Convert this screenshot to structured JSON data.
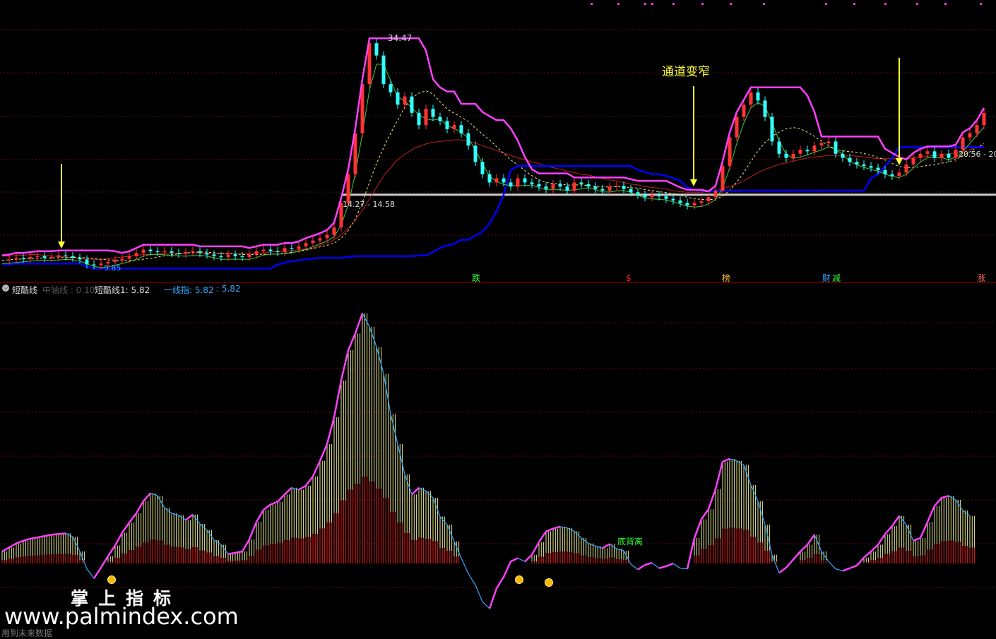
{
  "colors": {
    "background": "#000000",
    "grid": "#5a1515",
    "separator": "#a00000",
    "upper_band": "#ff40ff",
    "lower_band": "#0000ff",
    "mid_band": "#3cc93c",
    "ma_slow": "#c02020",
    "ma_dash": "#f0f080",
    "yellow": "#ffff33",
    "support": "#cccccc",
    "osc_line": "#33aaff",
    "osc_hist_red": "#c01818",
    "osc_hist_yellow": "#e8e890"
  },
  "upper_panel": {
    "peak_label": "34.47",
    "low_label": "5.85",
    "support_label": "14.27 - 14.58",
    "right_label": "20.56 - 20",
    "annotation": "通道变窄",
    "signals": [
      {
        "text": "跌",
        "color": "#33ff33"
      },
      {
        "text": "$",
        "color": "#ff2020"
      },
      {
        "text": "榜",
        "color": "#ffbb33"
      },
      {
        "text": "财",
        "color": "#33aaff"
      },
      {
        "text": "减",
        "color": "#33ff33"
      },
      {
        "text": "涨",
        "color": "#ff6666"
      }
    ]
  },
  "lower_panel": {
    "indicator_name": "短酷线",
    "legend_mid": "中轴线 : 0.10",
    "legend_1": "短酷线1: 5.82",
    "legend_2": "一线指: 5.82",
    "legend_3": ": 5.82",
    "divergence_label": "底背离"
  },
  "watermark": {
    "cn": "掌上指标",
    "url": "www.palmindex.com",
    "note": "用到未来数据"
  },
  "chart_data": [
    {
      "type": "line",
      "title": "",
      "x": [
        0,
        10,
        20,
        30,
        40,
        50,
        60,
        70,
        80,
        90,
        100,
        110,
        120,
        130,
        140,
        150,
        160,
        170,
        180,
        190,
        200,
        210,
        220,
        230,
        240,
        250,
        260,
        270,
        280,
        290,
        300,
        310,
        320,
        330,
        340,
        350,
        360,
        370,
        380,
        390,
        400,
        410,
        420,
        430,
        440,
        450,
        460,
        470,
        480,
        490,
        500,
        510,
        520,
        530,
        540,
        550,
        560,
        570,
        580,
        590,
        600,
        610,
        620,
        630,
        640,
        650,
        660,
        670,
        680,
        690,
        700,
        710,
        720,
        730,
        740,
        750,
        760,
        770,
        780,
        790,
        800,
        810,
        820,
        830,
        840,
        850,
        860,
        870,
        880,
        890,
        900,
        910,
        920,
        930,
        940,
        950,
        960,
        970,
        980,
        990,
        1000,
        1010,
        1020,
        1030,
        1040,
        1050,
        1060,
        1070,
        1080,
        1090,
        1100,
        1110,
        1120,
        1130,
        1140,
        1150,
        1160,
        1170,
        1180,
        1190,
        1200,
        1210,
        1220,
        1230,
        1240,
        1250,
        1260,
        1270,
        1280,
        1290,
        1300,
        1310,
        1320,
        1330,
        1340,
        1350,
        1360,
        1370,
        1380,
        1390
      ],
      "series": [
        {
          "values": [
            6.5,
            6.6,
            6.8,
            6.7,
            6.9,
            7.0,
            6.8,
            6.9,
            7.1,
            7.0,
            6.8,
            6.6,
            6.0,
            5.9,
            6.1,
            6.3,
            6.5,
            6.7,
            7.0,
            7.4,
            7.8,
            7.6,
            7.5,
            7.6,
            7.4,
            7.3,
            7.5,
            7.6,
            7.4,
            7.2,
            7.0,
            6.9,
            7.2,
            7.0,
            6.9,
            7.2,
            7.6,
            7.8,
            7.6,
            7.5,
            8.0,
            7.9,
            8.2,
            8.6,
            8.9,
            9.2,
            9.6,
            10.5,
            13.5,
            17.0,
            22.0,
            28.0,
            33.0,
            31.5,
            28.0,
            27.0,
            25.5,
            26.5,
            24.5,
            23.0,
            25.0,
            24.0,
            23.5,
            22.5,
            23.0,
            22.0,
            20.5,
            18.5,
            17.0,
            16.0,
            16.5,
            16.0,
            15.5,
            16.5,
            16.0,
            15.8,
            15.5,
            15.2,
            15.8,
            15.5,
            15.0,
            16.0,
            15.8,
            15.5,
            15.2,
            15.0,
            15.5,
            15.6,
            15.2,
            14.8,
            14.5,
            14.2,
            14.5,
            14.3,
            14.0,
            13.8,
            13.5,
            13.2,
            13.5,
            13.7,
            14.2,
            15.0,
            18.0,
            21.5,
            24.0,
            25.5,
            27.0,
            26.0,
            24.0,
            21.0,
            19.5,
            19.0,
            19.5,
            20.0,
            19.8,
            20.5,
            20.8,
            21.0,
            19.5,
            19.0,
            18.5,
            18.2,
            18.0,
            17.8,
            17.5,
            17.0,
            16.8,
            17.2,
            18.2,
            19.0,
            19.5,
            19.8,
            19.0,
            19.5,
            19.0,
            20.0,
            21.5,
            22.0,
            23.0,
            24.5
          ]
        },
        {
          "values": [
            7.0,
            7.0,
            7.1,
            7.1,
            7.2,
            7.2,
            7.1,
            7.0,
            7.0,
            6.9,
            6.8,
            6.7,
            6.7,
            6.6,
            6.6,
            6.7,
            6.8,
            6.9,
            7.0,
            7.1,
            7.2,
            7.2,
            7.3,
            7.3,
            7.3,
            7.3,
            7.4,
            7.4,
            7.4,
            7.3,
            7.3,
            7.3,
            7.3,
            7.3,
            7.3,
            7.3,
            7.4,
            7.4,
            7.5,
            7.6,
            7.6,
            7.7,
            7.8,
            7.9,
            8.0,
            8.3,
            8.6,
            9.0,
            9.6,
            10.4,
            11.4,
            12.6,
            14.0,
            15.4,
            16.8,
            17.8,
            18.8,
            19.4,
            20.0,
            20.4,
            20.7,
            20.9,
            21.0,
            21.1,
            21.2,
            21.2,
            21.0,
            20.8,
            20.5,
            20.2,
            19.9,
            19.6,
            19.3,
            19.0,
            18.8,
            18.5,
            18.3,
            18.0,
            17.8,
            17.6,
            17.4,
            17.2,
            17.0,
            16.9,
            16.7,
            16.5,
            16.3,
            16.2,
            16.0,
            15.8,
            15.7,
            15.5,
            15.4,
            15.3,
            15.2,
            15.0,
            14.9,
            14.8,
            14.8,
            14.8,
            14.9,
            15.0,
            15.2,
            15.5,
            15.8,
            16.2,
            16.7,
            17.2,
            17.6,
            17.9,
            18.2,
            18.4,
            18.6,
            18.8,
            19.0,
            19.1,
            19.2,
            19.3,
            19.3,
            19.3,
            19.3,
            19.2,
            19.1,
            19.0,
            18.9,
            18.9,
            18.9,
            18.9,
            18.9,
            19.0,
            19.1,
            19.2,
            19.3,
            19.4,
            19.5,
            19.6,
            19.8,
            20.0,
            20.3,
            20.6
          ]
        },
        {
          "values": [
            6.0,
            6.0,
            6.1,
            6.1,
            6.1,
            6.1,
            6.1,
            6.1,
            6.1,
            6.1,
            6.1,
            6.1,
            5.7,
            5.5,
            5.5,
            5.5,
            5.5,
            5.5,
            5.5,
            5.5,
            5.5,
            5.5,
            5.5,
            5.5,
            5.5,
            5.5,
            5.5,
            5.5,
            5.5,
            5.5,
            5.5,
            5.5,
            5.5,
            5.5,
            5.5,
            5.5,
            5.5,
            5.5,
            5.5,
            6.0,
            6.2,
            6.4,
            6.5,
            6.6,
            6.7,
            6.8,
            6.8,
            6.8,
            6.8,
            6.9,
            7.0,
            7.0,
            7.0,
            7.0,
            7.0,
            7.0,
            7.0,
            7.0,
            7.0,
            7.1,
            7.1,
            7.5,
            8.0,
            8.3,
            8.5,
            9.0,
            9.0,
            9.5,
            10.0,
            11.0,
            12.5,
            14.5,
            17.5,
            18.0,
            18.0,
            18.0,
            18.0,
            18.0,
            18.0,
            18.0,
            18.0,
            18.0,
            18.0,
            18.0,
            18.0,
            18.0,
            18.0,
            18.0,
            18.0,
            18.0,
            17.5,
            17.3,
            17.0,
            17.0,
            16.8,
            16.5,
            16.2,
            15.4,
            15.1,
            15.0,
            15.0,
            15.0,
            15.0,
            15.0,
            15.0,
            15.0,
            15.0,
            15.0,
            15.0,
            15.0,
            15.0,
            15.0,
            15.0,
            15.0,
            15.0,
            15.0,
            15.0,
            15.0,
            15.0,
            15.0,
            15.0,
            15.0,
            15.0,
            16.5,
            17.0,
            18.0,
            19.0,
            20.3,
            20.3,
            20.3,
            20.3,
            20.3,
            20.3,
            20.3,
            20.3,
            20.3,
            20.3,
            20.3,
            20.3,
            20.3
          ]
        }
      ]
    },
    {
      "type": "line",
      "title": "",
      "x": [
        0,
        10,
        20,
        30,
        40,
        50,
        60,
        70,
        80,
        90,
        100,
        110,
        120,
        130,
        140,
        150,
        160,
        170,
        180,
        190,
        200,
        210,
        220,
        230,
        240,
        250,
        260,
        270,
        280,
        290,
        300,
        310,
        320,
        330,
        340,
        350,
        360,
        370,
        380,
        390,
        400,
        410,
        420,
        430,
        440,
        450,
        460,
        470,
        480,
        490,
        500,
        510,
        520,
        530,
        540,
        550,
        560,
        570,
        580,
        590,
        600,
        610,
        620,
        630,
        640,
        650,
        660,
        670,
        680,
        690,
        700,
        710,
        720,
        730,
        740,
        750,
        760,
        770,
        780,
        790,
        800,
        810,
        820,
        830,
        840,
        850,
        860,
        870,
        880,
        890,
        900,
        910,
        920,
        930,
        940,
        950,
        960,
        970,
        980,
        990,
        1000,
        1010,
        1020,
        1030,
        1040,
        1050,
        1060,
        1070,
        1080,
        1090,
        1100,
        1110,
        1120,
        1130,
        1140,
        1150,
        1160,
        1170,
        1180,
        1190,
        1200,
        1210,
        1220,
        1230,
        1240,
        1250,
        1260,
        1270,
        1280,
        1290,
        1300,
        1310,
        1320,
        1330,
        1340,
        1350,
        1360,
        1370,
        1380,
        1390
      ],
      "series": [
        {
          "values": [
            2.0,
            2.6,
            3.2,
            3.6,
            3.9,
            4.1,
            4.3,
            4.5,
            4.6,
            4.7,
            4.2,
            2.0,
            -0.6,
            -2.0,
            -0.4,
            1.3,
            2.9,
            4.8,
            6.3,
            7.7,
            9.5,
            10.7,
            10.3,
            8.5,
            7.7,
            7.4,
            6.7,
            7.5,
            6.1,
            5.2,
            3.7,
            3.0,
            1.6,
            1.8,
            2.0,
            3.8,
            6.4,
            8.2,
            9.0,
            9.4,
            10.5,
            11.5,
            11.2,
            11.8,
            13.2,
            15.5,
            18.0,
            22.0,
            27.5,
            32.0,
            34.5,
            37.5,
            35.5,
            32.5,
            28.5,
            22.5,
            18.0,
            13.5,
            10.5,
            11.5,
            11.0,
            10.0,
            7.2,
            6.0,
            3.5,
            1.0,
            -1.3,
            -3.0,
            -5.5,
            -6.5,
            -3.5,
            -1.8,
            0.5,
            1.0,
            0.5,
            1.5,
            3.4,
            5.0,
            5.4,
            5.7,
            5.5,
            5.0,
            4.0,
            3.2,
            2.8,
            2.5,
            3.1,
            2.4,
            2.1,
            0.1,
            -0.7,
            0.0,
            0.3,
            -0.5,
            -0.2,
            0.2,
            -0.5,
            -0.6,
            4.0,
            6.8,
            8.3,
            11.3,
            15.4,
            15.8,
            15.5,
            14.9,
            11.9,
            9.5,
            6.0,
            1.5,
            -1.2,
            -0.4,
            0.8,
            2.0,
            3.0,
            4.5,
            2.0,
            0.5,
            -0.6,
            -0.9,
            -0.5,
            -0.1,
            1.1,
            2.0,
            3.0,
            4.6,
            5.8,
            7.3,
            6.0,
            3.6,
            4.0,
            6.4,
            8.8,
            10.0,
            10.3,
            9.7,
            8.1,
            7.3
          ]
        }
      ]
    }
  ]
}
